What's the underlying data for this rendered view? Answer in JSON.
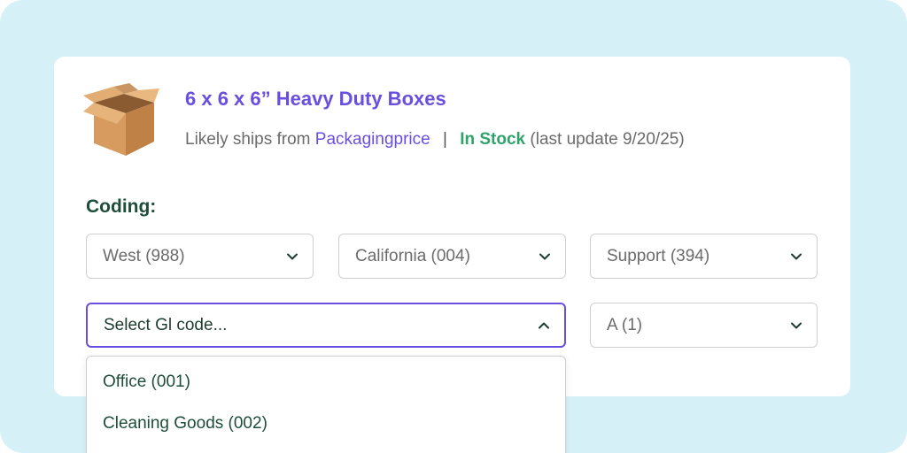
{
  "product": {
    "icon": "cardboard-box-icon",
    "title": "6 x 6 x 6” Heavy Duty Boxes",
    "ships_prefix": "Likely ships from",
    "vendor": "Packagingprice",
    "separator": "|",
    "stock_status": "In Stock",
    "last_update": "(last update 9/20/25)"
  },
  "coding": {
    "label": "Coding:",
    "region_select": "West (988)",
    "state_select": "California (004)",
    "department_select": "Support (394)",
    "gl_select_placeholder": "Select Gl code...",
    "class_select": "A (1)",
    "gl_options": [
      "Office (001)",
      "Cleaning Goods (002)"
    ]
  },
  "colors": {
    "accent_purple": "#6a4ee0",
    "stock_green": "#2fa36b",
    "heading_dark_green": "#1e4d3b",
    "background": "#d6f0f7"
  }
}
